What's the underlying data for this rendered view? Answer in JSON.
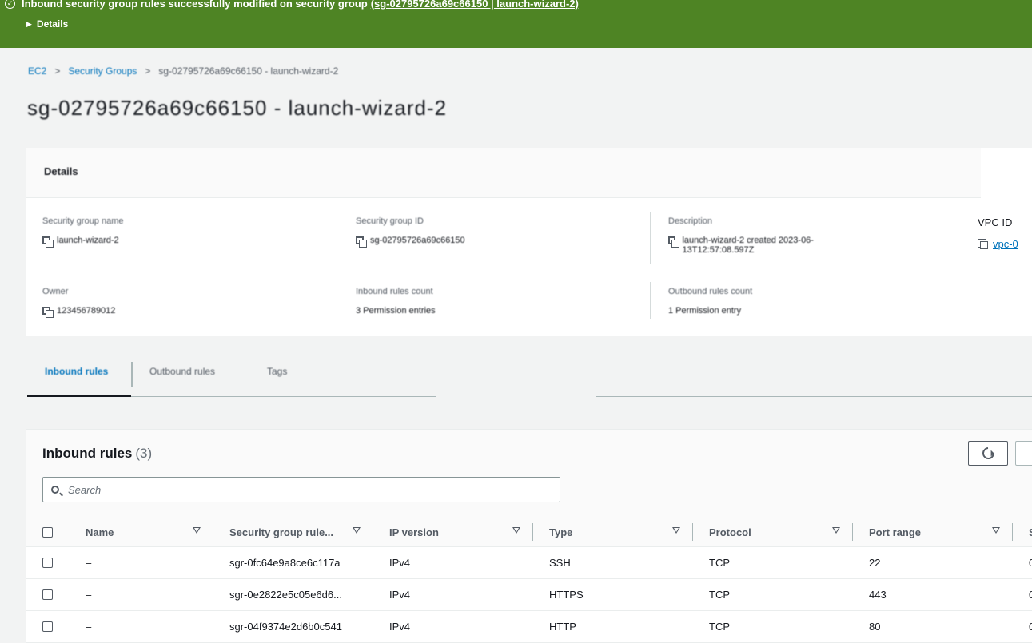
{
  "flash": {
    "message": "Inbound security group rules successfully modified on security group",
    "link": "(sg-02795726a69c66150 | launch-wizard-2)",
    "details_label": "Details",
    "color": "#4e8424"
  },
  "breadcrumb": {
    "items": [
      "EC2",
      "Security Groups",
      "sg-02795726a69c66150 - launch-wizard-2"
    ],
    "separator": ">"
  },
  "page_title": "sg-02795726a69c66150 - launch-wizard-2",
  "details": {
    "title": "Details",
    "fields": [
      {
        "label": "Security group name",
        "value": "launch-wizard-2"
      },
      {
        "label": "Security group ID",
        "value": "sg-02795726a69c66150"
      },
      {
        "label": "Description",
        "value": "launch-wizard-2 created 2023-06-13T12:57:08.597Z"
      },
      {
        "label": "VPC ID",
        "value": "vpc-0"
      },
      {
        "label": "Owner",
        "value": "123456789012"
      },
      {
        "label": "Inbound rules count",
        "value": "3 Permission entries"
      },
      {
        "label": "Outbound rules count",
        "value": "1 Permission entry"
      }
    ]
  },
  "tabs": [
    "Inbound rules",
    "Outbound rules",
    "Tags"
  ],
  "rules": {
    "title": "Inbound rules",
    "count": "(3)",
    "search_placeholder": "Search",
    "columns": [
      "Name",
      "Security group rule...",
      "IP version",
      "Type",
      "Protocol",
      "Port range",
      "S"
    ],
    "rows": [
      {
        "name": "–",
        "rule_id": "sgr-0fc64e9a8ce6c117a",
        "ip_version": "IPv4",
        "type": "SSH",
        "protocol": "TCP",
        "port": "22",
        "source": "0"
      },
      {
        "name": "–",
        "rule_id": "sgr-0e2822e5c05e6d6...",
        "ip_version": "IPv4",
        "type": "HTTPS",
        "protocol": "TCP",
        "port": "443",
        "source": "0"
      },
      {
        "name": "–",
        "rule_id": "sgr-04f9374e2d6b0c541",
        "ip_version": "IPv4",
        "type": "HTTP",
        "protocol": "TCP",
        "port": "80",
        "source": "0"
      }
    ]
  },
  "colors": {
    "link": "#0073bb",
    "text": "#16191f",
    "muted": "#545b64"
  }
}
